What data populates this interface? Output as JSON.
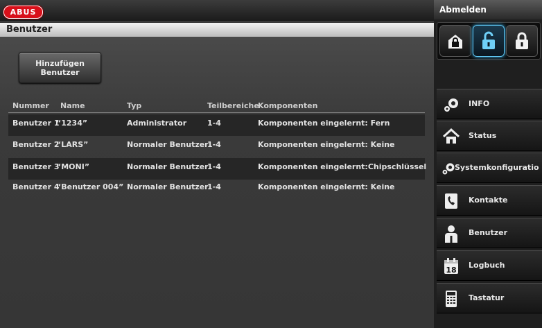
{
  "brand": "ABUS",
  "page_title": "Benutzer",
  "add_button_label": "Hinzufügen\nBenutzer",
  "table": {
    "headers": {
      "nummer": "Nummer",
      "name": "Name",
      "typ": "Typ",
      "teilbereiche": "Teilbereiche",
      "komponenten": "Komponenten"
    },
    "rows": [
      {
        "nummer": "Benutzer 1",
        "name": "“1234”",
        "typ": "Administrator",
        "teilbereiche": "1-4",
        "komponenten": "Komponenten eingelernt: Fern"
      },
      {
        "nummer": "Benutzer 2",
        "name": "“LARS”",
        "typ": "Normaler Benutzer",
        "teilbereiche": "1-4",
        "komponenten": "Komponenten eingelernt: Keine"
      },
      {
        "nummer": "Benutzer 3",
        "name": "“MONI”",
        "typ": "Normaler Benutzer",
        "teilbereiche": "1-4",
        "komponenten": "Komponenten eingelernt:Chipschlüssel"
      },
      {
        "nummer": "Benutzer 4",
        "name": "“Benutzer 004”",
        "typ": "Normaler Benutzer",
        "teilbereiche": "1-4",
        "komponenten": "Komponenten eingelernt: Keine"
      }
    ]
  },
  "sidebar": {
    "logout_label": "Abmelden",
    "modes": [
      {
        "icon": "lock-closed-icon",
        "active": false
      },
      {
        "icon": "lock-open-icon",
        "active": true
      },
      {
        "icon": "lock-closed-icon",
        "active": false
      }
    ],
    "items": [
      {
        "label": "INFO",
        "icon": "gears-icon"
      },
      {
        "label": "Status",
        "icon": "house-icon"
      },
      {
        "label": "Systemkonfiguratio",
        "icon": "gears-icon"
      },
      {
        "label": "Kontakte",
        "icon": "phone-book-icon"
      },
      {
        "label": "Benutzer",
        "icon": "user-icon"
      },
      {
        "label": "Logbuch",
        "icon": "calendar-icon"
      },
      {
        "label": "Tastatur",
        "icon": "keypad-icon"
      }
    ],
    "calendar_day": "18"
  },
  "colors": {
    "brand_red": "#d8101a",
    "active_accent": "#5fc7f3"
  }
}
